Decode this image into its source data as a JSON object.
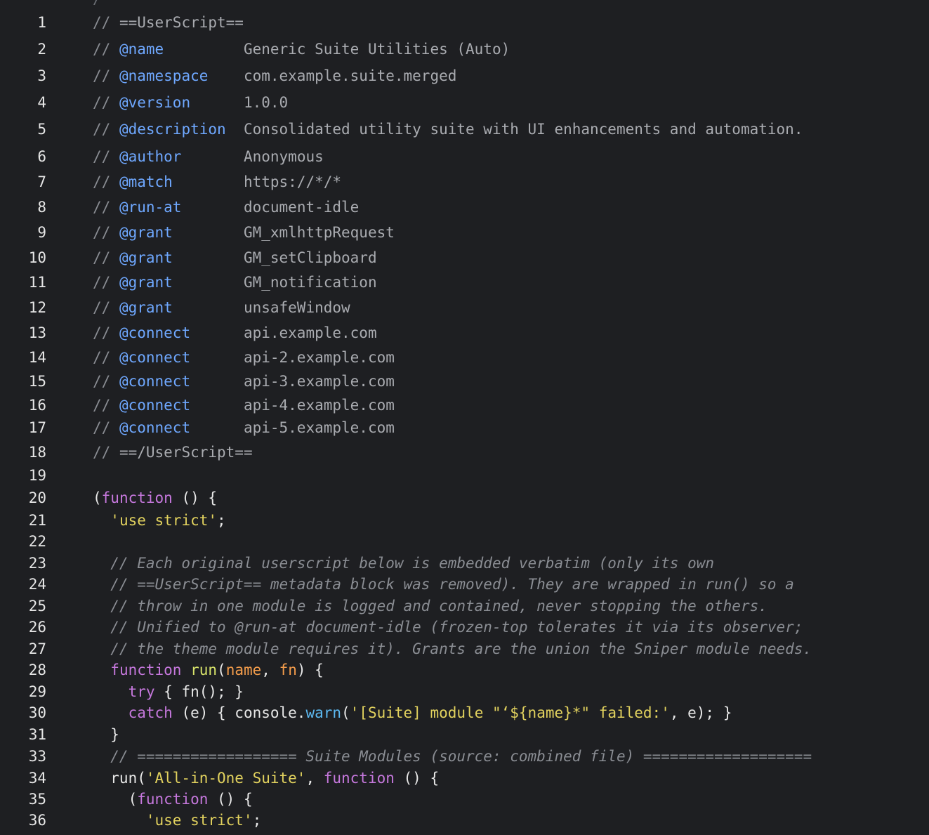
{
  "editor": {
    "top_partial_text": "/**",
    "lines": [
      {
        "n": "1",
        "segments": [
          [
            "mc",
            "// "
          ],
          [
            "mv",
            "==UserScript=="
          ]
        ]
      },
      {
        "n": "2",
        "segments": [
          [
            "mc",
            "// "
          ],
          [
            "mk",
            "@name"
          ],
          [
            "mv",
            "         Generic Suite Utilities (Auto)"
          ]
        ]
      },
      {
        "n": "3",
        "segments": [
          [
            "mc",
            "// "
          ],
          [
            "mk",
            "@namespace"
          ],
          [
            "mv",
            "    com.example.suite.merged"
          ]
        ]
      },
      {
        "n": "4",
        "segments": [
          [
            "mc",
            "// "
          ],
          [
            "mk",
            "@version"
          ],
          [
            "mv",
            "      1.0.0"
          ]
        ]
      },
      {
        "n": "5",
        "segments": [
          [
            "mc",
            "// "
          ],
          [
            "mk",
            "@description"
          ],
          [
            "mv",
            "  Consolidated utility suite with UI enhancements and automation."
          ]
        ]
      },
      {
        "n": "6",
        "segments": [
          [
            "mc",
            "// "
          ],
          [
            "mk",
            "@author"
          ],
          [
            "mv",
            "       Anonymous"
          ]
        ]
      },
      {
        "n": "7",
        "segments": [
          [
            "mc",
            "// "
          ],
          [
            "mk",
            "@match"
          ],
          [
            "mv",
            "        https://*/*"
          ]
        ]
      },
      {
        "n": "8",
        "segments": [
          [
            "mc",
            "// "
          ],
          [
            "mk",
            "@run-at"
          ],
          [
            "mv",
            "       document-idle"
          ]
        ]
      },
      {
        "n": "9",
        "segments": [
          [
            "mc",
            "// "
          ],
          [
            "mk",
            "@grant"
          ],
          [
            "mv",
            "        GM_xmlhttpRequest"
          ]
        ]
      },
      {
        "n": "10",
        "segments": [
          [
            "mc",
            "// "
          ],
          [
            "mk",
            "@grant"
          ],
          [
            "mv",
            "        GM_setClipboard"
          ]
        ]
      },
      {
        "n": "11",
        "segments": [
          [
            "mc",
            "// "
          ],
          [
            "mk",
            "@grant"
          ],
          [
            "mv",
            "        GM_notification"
          ]
        ]
      },
      {
        "n": "12",
        "segments": [
          [
            "mc",
            "// "
          ],
          [
            "mk",
            "@grant"
          ],
          [
            "mv",
            "        unsafeWindow"
          ]
        ]
      },
      {
        "n": "13",
        "segments": [
          [
            "mc",
            "// "
          ],
          [
            "mk",
            "@connect"
          ],
          [
            "mv",
            "      api.example.com"
          ]
        ]
      },
      {
        "n": "14",
        "segments": [
          [
            "mc",
            "// "
          ],
          [
            "mk",
            "@connect"
          ],
          [
            "mv",
            "      api-2.example.com"
          ]
        ]
      },
      {
        "n": "15",
        "segments": [
          [
            "mc",
            "// "
          ],
          [
            "mk",
            "@connect"
          ],
          [
            "mv",
            "      api-3.example.com"
          ]
        ]
      },
      {
        "n": "16",
        "segments": [
          [
            "mc",
            "// "
          ],
          [
            "mk",
            "@connect"
          ],
          [
            "mv",
            "      api-4.example.com"
          ]
        ]
      },
      {
        "n": "17",
        "segments": [
          [
            "mc",
            "// "
          ],
          [
            "mk",
            "@connect"
          ],
          [
            "mv",
            "      api-5.example.com"
          ]
        ]
      },
      {
        "n": "18",
        "segments": [
          [
            "mc",
            "// "
          ],
          [
            "mv",
            "==/UserScript=="
          ]
        ]
      },
      {
        "n": "19",
        "segments": []
      },
      {
        "n": "20",
        "segments": [
          [
            "pl",
            "("
          ],
          [
            "kw",
            "function"
          ],
          [
            "pl",
            " () {"
          ]
        ]
      },
      {
        "n": "21",
        "segments": [
          [
            "pl",
            "  "
          ],
          [
            "st",
            "'use strict'"
          ],
          [
            "pl",
            ";"
          ]
        ]
      },
      {
        "n": "22",
        "segments": []
      },
      {
        "n": "23",
        "segments": [
          [
            "cm",
            "  // Each original userscript below is embedded verbatim (only its own"
          ]
        ]
      },
      {
        "n": "24",
        "segments": [
          [
            "cm",
            "  // ==UserScript== metadata block was removed). They are wrapped in run() so a"
          ]
        ]
      },
      {
        "n": "25",
        "segments": [
          [
            "cm",
            "  // throw in one module is logged and contained, never stopping the others."
          ]
        ]
      },
      {
        "n": "26",
        "segments": [
          [
            "cm",
            "  // Unified to @run-at document-idle (frozen-top tolerates it via its observer;"
          ]
        ]
      },
      {
        "n": "27",
        "segments": [
          [
            "cm",
            "  // the theme module requires it). Grants are the union the Sniper module needs."
          ]
        ]
      },
      {
        "n": "28",
        "segments": [
          [
            "pl",
            "  "
          ],
          [
            "kw",
            "function"
          ],
          [
            "pl",
            " "
          ],
          [
            "fn",
            "run"
          ],
          [
            "pl",
            "("
          ],
          [
            "pr",
            "name"
          ],
          [
            "pl",
            ", "
          ],
          [
            "pr",
            "fn"
          ],
          [
            "pl",
            ") {"
          ]
        ]
      },
      {
        "n": "29",
        "segments": [
          [
            "pl",
            "    "
          ],
          [
            "kw",
            "try"
          ],
          [
            "pl",
            " { fn(); }"
          ]
        ]
      },
      {
        "n": "30",
        "segments": [
          [
            "pl",
            "    "
          ],
          [
            "kw",
            "catch"
          ],
          [
            "pl",
            " (e) { console."
          ],
          [
            "mt",
            "warn"
          ],
          [
            "pl",
            "("
          ],
          [
            "st",
            "'[Suite] module \"‘${name}*\" failed:'"
          ],
          [
            "pl",
            ", e); }"
          ]
        ]
      },
      {
        "n": "31",
        "segments": [
          [
            "pl",
            "  }"
          ]
        ]
      },
      {
        "n": "33",
        "segments": [
          [
            "cm",
            "  // ================== Suite Modules (source: combined file) ==================="
          ]
        ]
      },
      {
        "n": "34",
        "segments": [
          [
            "pl",
            "  run("
          ],
          [
            "st",
            "'All-in-One Suite'"
          ],
          [
            "pl",
            ", "
          ],
          [
            "kw",
            "function"
          ],
          [
            "pl",
            " () {"
          ]
        ]
      },
      {
        "n": "35",
        "segments": [
          [
            "pl",
            "    ("
          ],
          [
            "kw",
            "function"
          ],
          [
            "pl",
            " () {"
          ]
        ]
      },
      {
        "n": "36",
        "segments": [
          [
            "pl",
            "      "
          ],
          [
            "st",
            "'use strict'"
          ],
          [
            "pl",
            ";"
          ]
        ]
      }
    ]
  }
}
